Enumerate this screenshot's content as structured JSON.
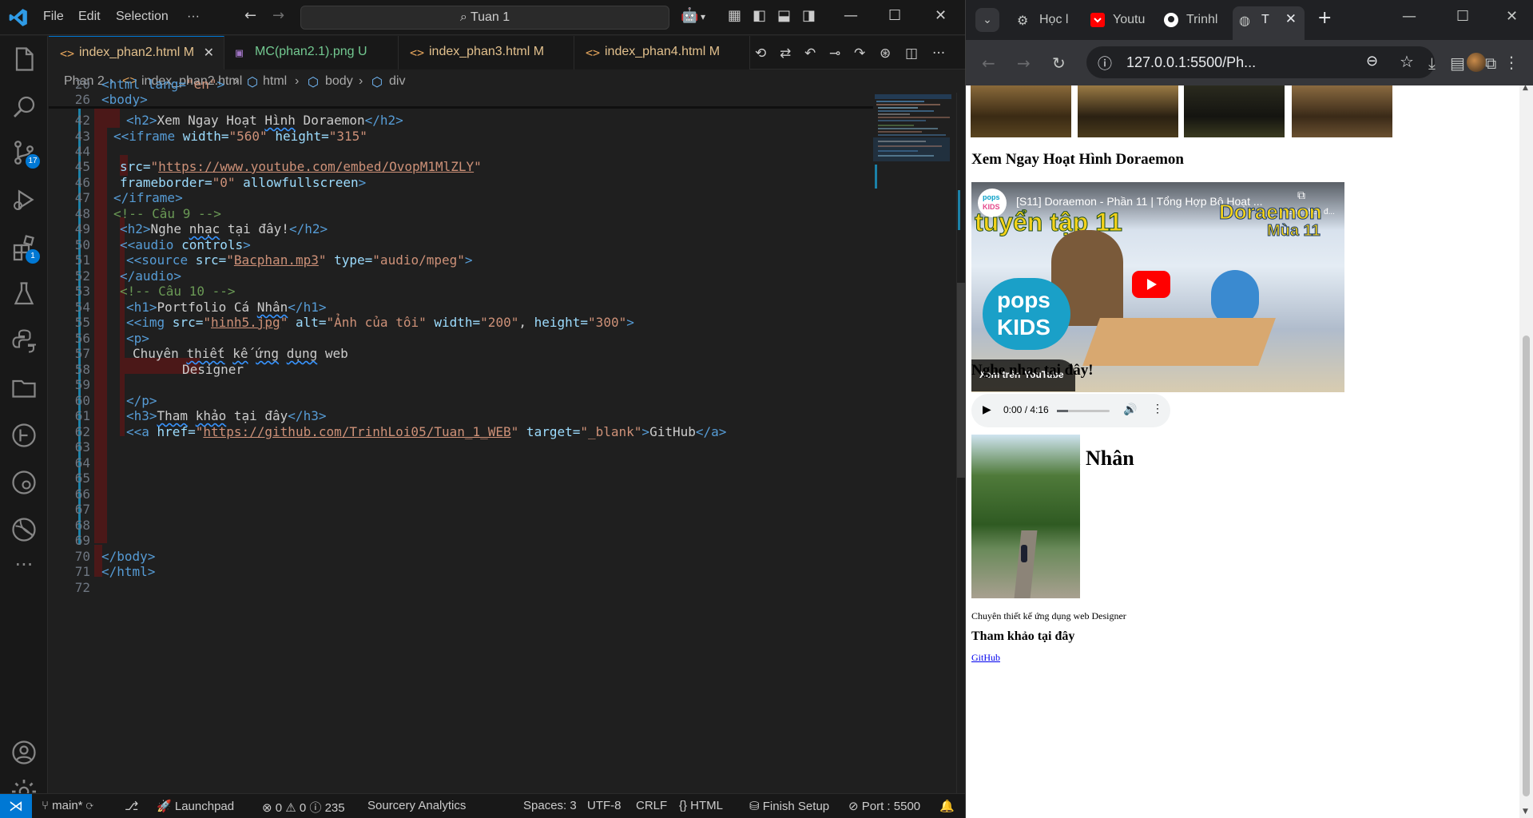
{
  "vscode": {
    "menu": [
      "File",
      "Edit",
      "Selection",
      "···"
    ],
    "search": "Tuan 1",
    "tabs": [
      {
        "label": "index_phan2.html",
        "status": "M",
        "icon": "<>",
        "color": "#e2a35b",
        "active": true
      },
      {
        "label": "MC(phan2.1).png",
        "status": "U",
        "icon": "▣",
        "color": "#73c991",
        "active": false
      },
      {
        "label": "index_phan3.html",
        "status": "M",
        "icon": "<>",
        "color": "#e2a35b",
        "active": false
      },
      {
        "label": "index_phan4.html",
        "status": "M",
        "icon": "<>",
        "color": "#e2a35b",
        "active": false
      }
    ],
    "breadcrumb": [
      "Phan 2",
      "index_phan2.html",
      "html",
      "body",
      "div"
    ],
    "activity_badges": {
      "source_control": "17",
      "extensions": "1"
    },
    "status": {
      "branch": "main*",
      "launchpad": "Launchpad",
      "problems": "0",
      "warnings": "0",
      "info": "235",
      "sourcery": "Sourcery Analytics",
      "spaces": "Spaces: 3",
      "encoding": "UTF-8",
      "eol": "CRLF",
      "language": "{} HTML",
      "finish": "Finish Setup",
      "port": "Port : 5500"
    }
  },
  "code_lines": [
    {
      "n": "20",
      "sticky": true
    },
    {
      "n": "26",
      "sticky": true
    },
    {
      "n": "42"
    },
    {
      "n": "43"
    },
    {
      "n": "44"
    },
    {
      "n": "45"
    },
    {
      "n": "46"
    },
    {
      "n": "47"
    },
    {
      "n": "48"
    },
    {
      "n": "49"
    },
    {
      "n": "50"
    },
    {
      "n": "51"
    },
    {
      "n": "52"
    },
    {
      "n": "53"
    },
    {
      "n": "54"
    },
    {
      "n": "55"
    },
    {
      "n": "56"
    },
    {
      "n": "57"
    },
    {
      "n": "58"
    },
    {
      "n": "59"
    },
    {
      "n": "60"
    },
    {
      "n": "61"
    },
    {
      "n": "62"
    },
    {
      "n": "63"
    },
    {
      "n": "64"
    },
    {
      "n": "65"
    },
    {
      "n": "66"
    },
    {
      "n": "67"
    },
    {
      "n": "68"
    },
    {
      "n": "69"
    },
    {
      "n": "70"
    },
    {
      "n": "71"
    },
    {
      "n": "72"
    }
  ],
  "code": {
    "l20": [
      "<html lang=",
      "\"en\"",
      ">"
    ],
    "l26": "<body>",
    "l42a": "<h2>",
    "l42b": "Xem Ngay Hoạt ",
    "l42c": "Hình",
    "l42d": " Doraemon",
    "l42e": "</h2>",
    "l43a": "<iframe",
    "l43b": " width=",
    "l43c": "\"560\"",
    "l43d": " height=",
    "l43e": "\"315\"",
    "l45a": "src=",
    "l45b": "\"",
    "l45c": "https://www.youtube.com/embed/OvopM1MlZLY",
    "l45d": "\"",
    "l46a": "frameborder=",
    "l46b": "\"0\"",
    "l46c": " allowfullscreen",
    "l46d": ">",
    "l47": "</iframe>",
    "l48": "<!-- Câu 9 -->",
    "l49a": "<h2>",
    "l49b": "Nghe ",
    "l49c": "nhạc",
    "l49d": " tại đây!",
    "l49e": "</h2>",
    "l50a": "<audio",
    "l50b": " controls",
    "l50c": ">",
    "l51a": "<source",
    "l51b": " src=",
    "l51c": "\"",
    "l51d": "Bacphan.mp3",
    "l51e": "\"",
    "l51f": " type=",
    "l51g": "\"audio/mpeg\"",
    "l51h": ">",
    "l52": "</audio>",
    "l53": "<!-- Câu 10 -->",
    "l54a": "<h1>",
    "l54b": "Portfolio Cá ",
    "l54c": "Nhân",
    "l54d": "</h1>",
    "l55a": "<img",
    "l55b": " src=",
    "l55c": "\"",
    "l55d": "hinh5.jpg",
    "l55e": "\"",
    "l55f": " alt=",
    "l55g": "\"Ảnh của tôi\"",
    "l55h": " width=",
    "l55i": "\"200\"",
    "l55j": ", ",
    "l55k": "height=",
    "l55l": "\"300\"",
    "l55m": ">",
    "l56": "<p>",
    "l57a": "Chuyên ",
    "l57b": "thiết",
    "l57c": " ",
    "l57d": "kế",
    "l57e": " ",
    "l57f": "ứng",
    "l57g": " ",
    "l57h": "dụng",
    "l57i": " web",
    "l58": "Designer",
    "l60": "</p>",
    "l61a": "<h3>",
    "l61b": "Tham",
    "l61c": " ",
    "l61d": "khảo",
    "l61e": " tại đây",
    "l61f": "</h3>",
    "l62a": "<a",
    "l62b": " href=",
    "l62c": "\"",
    "l62d": "https://github.com/TrinhLoi05/Tuan_1_WEB",
    "l62e": "\"",
    "l62f": " target=",
    "l62g": "\"_blank\"",
    "l62h": ">",
    "l62i": "GitHub",
    "l62j": "</a>",
    "l70": "</body>",
    "l71": "</html>"
  },
  "chrome": {
    "tabs": [
      {
        "label": "Học l",
        "icon_color": "#c4c7c5"
      },
      {
        "label": "Youtu",
        "icon_color": "#ff0000"
      },
      {
        "label": "Trinhl",
        "icon_color": "#ffffff"
      },
      {
        "label": "T",
        "icon_color": "#c4c7c5"
      }
    ],
    "url": "127.0.0.1:5500/Ph..."
  },
  "page": {
    "h2_video": "Xem Ngay Hoạt Hình Doraemon",
    "video_title": "[S11] Doraemon - Phần 11 | Tổng Hợp Bộ Hoạt ...",
    "video_copy": "Sao chép đ...",
    "video_watch_on": "Xem trên",
    "video_brand": "YouTube",
    "video_logo_top": "pops",
    "video_logo_bottom": "KIDS",
    "video_banner_left": "tuyển tập 11",
    "video_banner_right_1": "Doraemon",
    "video_banner_right_2": "Mùa 11",
    "h2_music": "Nghe nhạc tại đây!",
    "audio_time": "0:00 / 4:16",
    "h1_portfolio": "Portfolio Cá Nhân",
    "p_text": "Chuyên thiết kế ứng dụng web Designer",
    "h3_ref": "Tham khảo tại đây",
    "link": "GitHub"
  }
}
